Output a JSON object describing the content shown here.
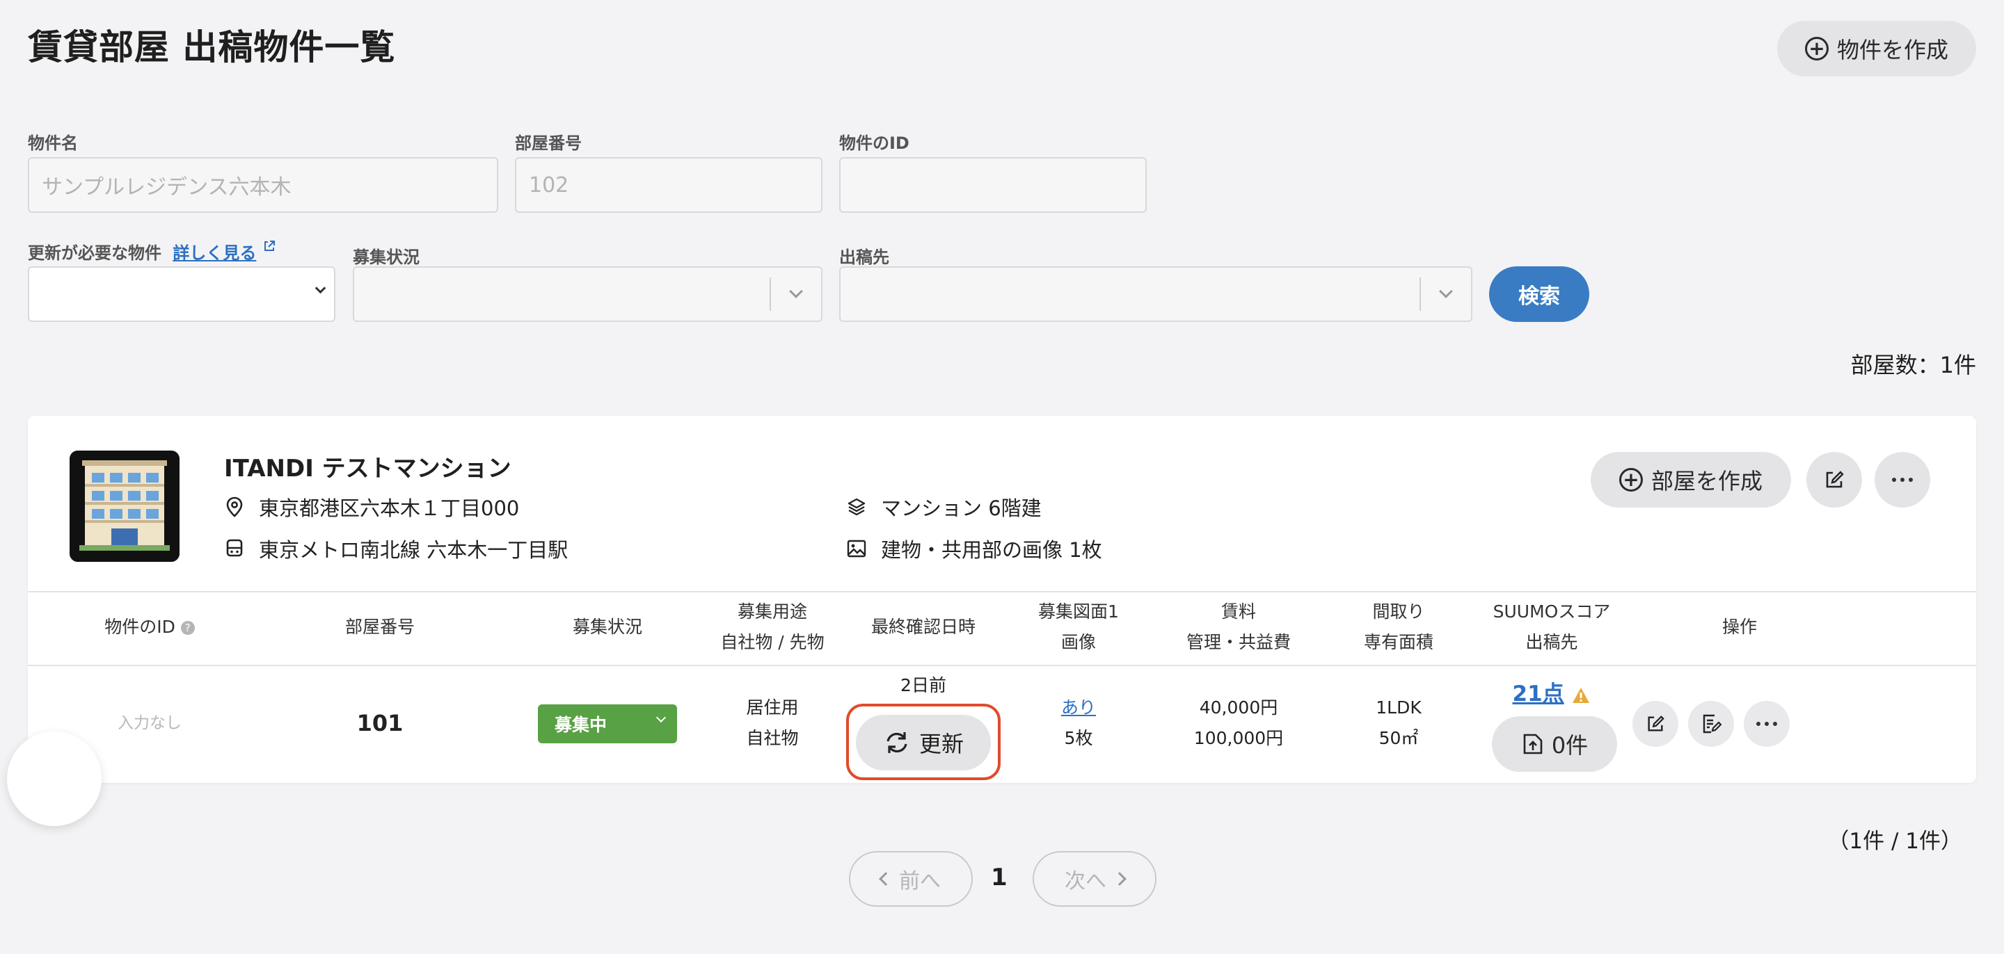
{
  "page": {
    "title": "賃貸部屋 出稿物件一覧",
    "create_property_label": "物件を作成"
  },
  "filters": {
    "property_name": {
      "label": "物件名",
      "placeholder": "サンプルレジデンス六本木"
    },
    "room_number": {
      "label": "部屋番号",
      "placeholder": "102"
    },
    "property_id": {
      "label": "物件のID",
      "placeholder": ""
    },
    "needs_update": {
      "label": "更新が必要な物件",
      "link": "詳しく見る"
    },
    "recruit_status": {
      "label": "募集状況"
    },
    "publish_to": {
      "label": "出稿先"
    },
    "search_label": "検索"
  },
  "room_count": "部屋数：1件",
  "property": {
    "name": "ITANDI テストマンション",
    "address": "東京都港区六本木１丁目000",
    "station": "東京メトロ南北線 六本木一丁目駅",
    "building": "マンション 6階建",
    "images": "建物・共用部の画像 1枚",
    "create_room_label": "部屋を作成"
  },
  "table": {
    "headers": {
      "id": "物件のID",
      "room": "部屋番号",
      "status": "募集状況",
      "usage_1": "募集用途",
      "usage_2": "自社物 / 先物",
      "checked": "最終確認日時",
      "floorplan_1": "募集図面1",
      "floorplan_2": "画像",
      "rent_1": "賃料",
      "rent_2": "管理・共益費",
      "layout_1": "間取り",
      "layout_2": "専有面積",
      "suumo_1": "SUUMOスコア",
      "suumo_2": "出稿先",
      "ops": "操作"
    },
    "row": {
      "id": "入力なし",
      "room": "101",
      "status": "募集中",
      "usage_1": "居住用",
      "usage_2": "自社物",
      "checked_ago": "2日前",
      "refresh_label": "更新",
      "floorplan_link": "あり",
      "images_count": "5枚",
      "rent": "40,000円",
      "fee": "100,000円",
      "layout": "1LDK",
      "area": "50㎡",
      "suumo_score": "21点",
      "publish_count": "0件"
    }
  },
  "pagination": {
    "summary": "（1件 / 1件）",
    "prev": "前へ",
    "current": "1",
    "next": "次へ"
  },
  "colors": {
    "accent": "#3a7cc3",
    "status_green": "#58a144",
    "highlight": "#e04b2c",
    "warning": "#e8a93a"
  }
}
